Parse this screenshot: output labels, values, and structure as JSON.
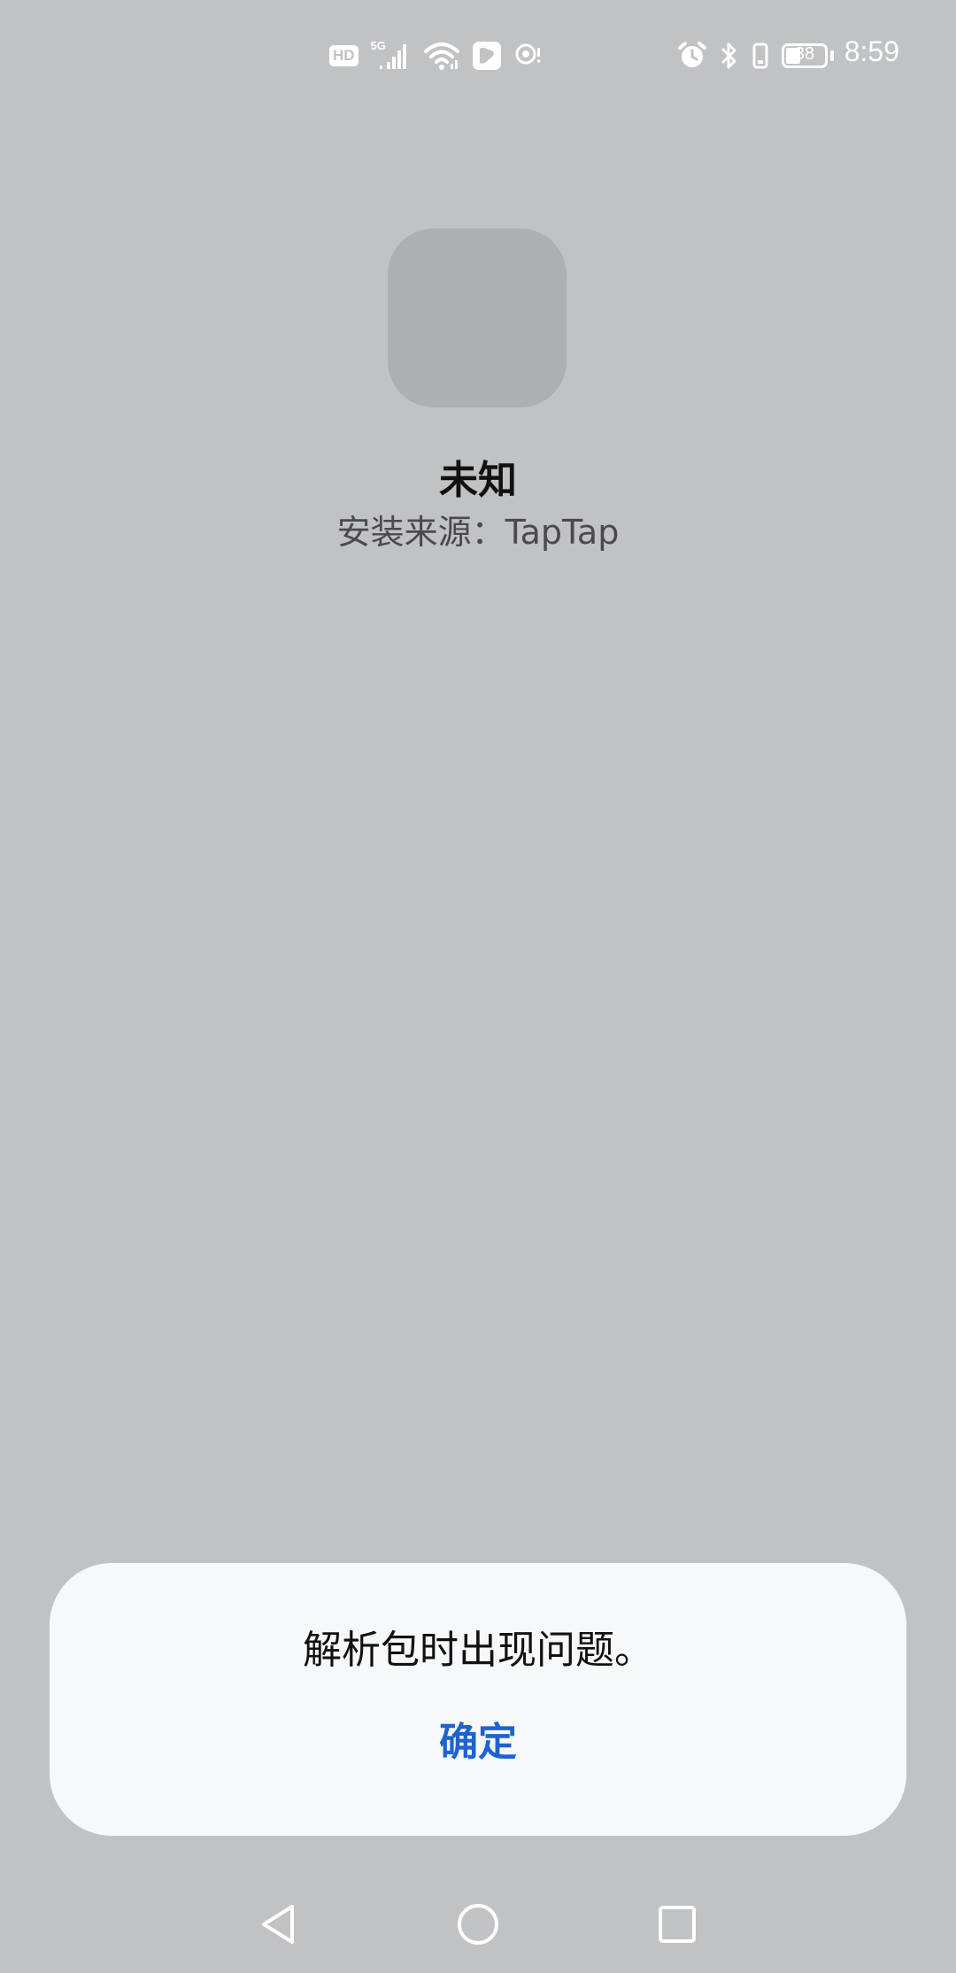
{
  "status_bar": {
    "time": "8:59",
    "hd_label": "HD",
    "network_label": "5G",
    "battery_level": "38",
    "icons_left": [
      "hd-icon",
      "signal-5g-icon",
      "wifi-icon",
      "app-notification-icon",
      "nfc-icon"
    ],
    "icons_right": [
      "alarm-icon",
      "bluetooth-icon",
      "vibrate-icon",
      "battery-icon"
    ]
  },
  "app": {
    "name": "未知",
    "source": "安装来源：TapTap"
  },
  "dialog": {
    "message": "解析包时出现问题。",
    "confirm_label": "确定",
    "confirm_color": "#1e63cf"
  },
  "nav_bar": {
    "buttons": [
      "back-icon",
      "home-icon",
      "recents-icon"
    ]
  },
  "colors": {
    "background": "#c1c2c4",
    "dialog_background": "#f7f8fa",
    "icon_placeholder": "#aeafb1"
  }
}
